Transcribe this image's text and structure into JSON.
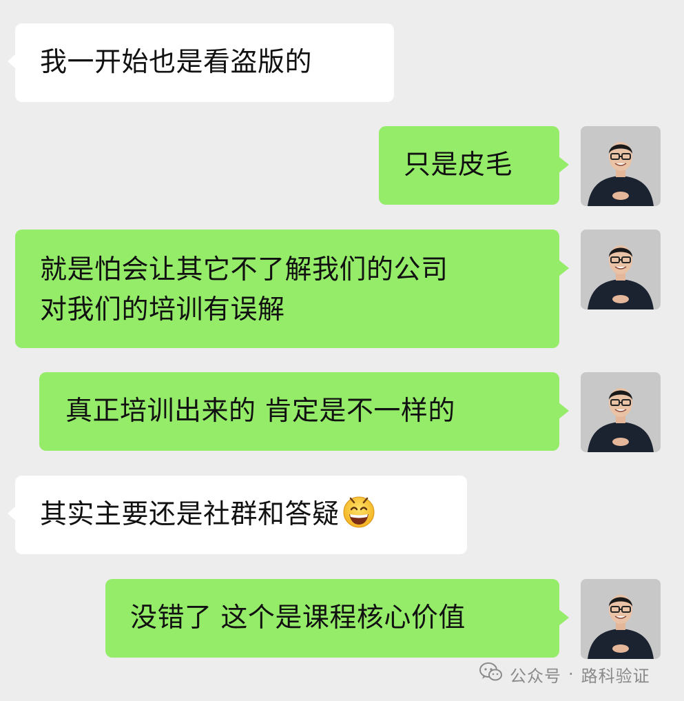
{
  "messages": [
    {
      "side": "left",
      "lines": [
        "我一开始也是看盗版的"
      ]
    },
    {
      "side": "right",
      "lines": [
        "只是皮毛"
      ]
    },
    {
      "side": "right",
      "lines": [
        "就是怕会让其它不了解我们的公司",
        "对我们的培训有误解"
      ]
    },
    {
      "side": "right",
      "lines": [
        "真正培训出来的 肯定是不一样的"
      ]
    },
    {
      "side": "left",
      "lines": [
        "其实主要还是社群和答疑"
      ],
      "emoji": "grinning-face-emoji"
    },
    {
      "side": "right",
      "lines": [
        "没错了 这个是课程核心价值"
      ]
    }
  ],
  "footer": {
    "icon": "wechat-icon",
    "source": "公众号",
    "separator": "·",
    "account": "路科验证"
  },
  "colors": {
    "background": "#ededed",
    "bubble_left": "#ffffff",
    "bubble_right": "#95ec69"
  }
}
